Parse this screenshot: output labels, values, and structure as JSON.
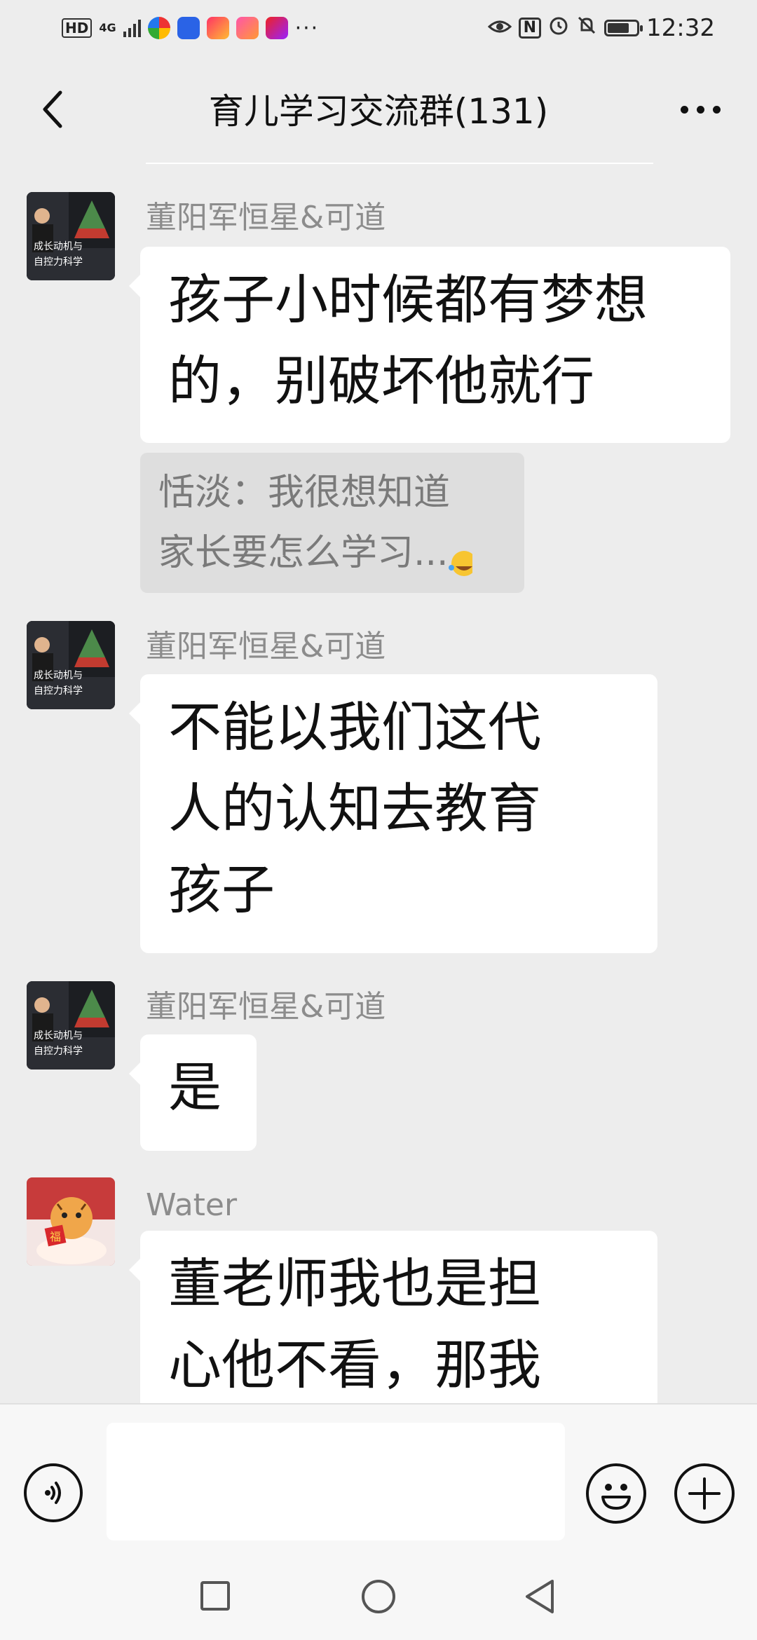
{
  "status_bar": {
    "hd": "HD",
    "network": "4G",
    "more": "···",
    "nfc": "N",
    "time": "12:32"
  },
  "header": {
    "title": "育儿学习交流群(131)"
  },
  "messages": [
    {
      "sender": "董阳军恒星&可道",
      "avatar_text": [
        "成长动机与",
        "自控力科学"
      ],
      "lines": [
        "孩子小时候都有梦想",
        "的，别破坏他就行"
      ],
      "quote_lines": [
        "恬淡：我很想知道",
        "家长要怎么学习..."
      ]
    },
    {
      "sender": "董阳军恒星&可道",
      "avatar_text": [
        "成长动机与",
        "自控力科学"
      ],
      "lines": [
        "不能以我们这代",
        "人的认知去教育",
        "孩子"
      ]
    },
    {
      "sender": "董阳军恒星&可道",
      "avatar_text": [
        "成长动机与",
        "自控力科学"
      ],
      "lines": [
        "是"
      ]
    },
    {
      "sender": "Water",
      "avatar_glyph": "福",
      "lines": [
        "董老师我也是担",
        "心他不看，那我"
      ]
    }
  ],
  "input": {
    "placeholder": ""
  },
  "icons": {
    "back": "chevron-left-icon",
    "more": "more-dots-icon",
    "voice": "voice-icon",
    "emoji": "emoji-icon",
    "plus": "plus-icon",
    "quote_emoji": "laughing-tears-emoji-icon"
  },
  "colors": {
    "background": "#ededed",
    "bubble": "#ffffff",
    "quote": "#dedede",
    "sender": "#8c8c8c"
  }
}
